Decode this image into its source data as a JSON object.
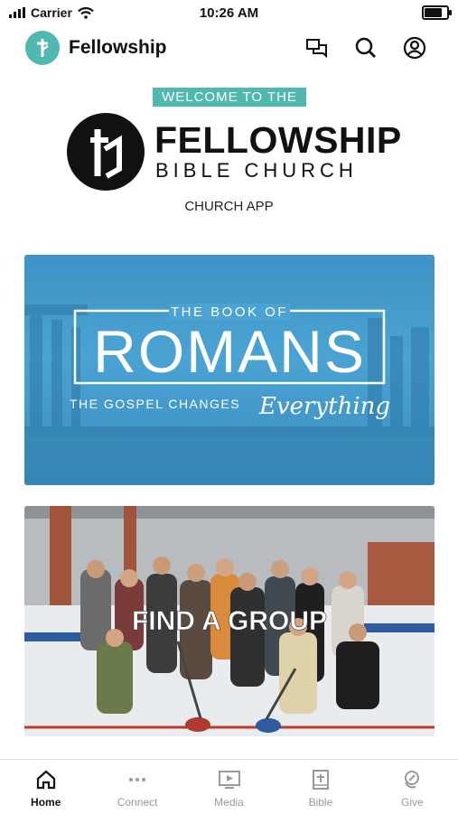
{
  "status": {
    "carrier": "Carrier",
    "time": "10:26 AM",
    "battery_level": 0.85
  },
  "header": {
    "title": "Fellowship",
    "icons": [
      "chat-icon",
      "search-icon",
      "account-icon"
    ]
  },
  "welcome": {
    "banner": "WELCOME TO THE",
    "logo_line1": "FELLOWSHIP",
    "logo_line2": "BIBLE CHURCH",
    "subtitle": "CHURCH APP"
  },
  "cards": [
    {
      "kicker": "THE BOOK OF",
      "title": "ROMANS",
      "tagline": "THE GOSPEL CHANGES",
      "script": "Everything"
    },
    {
      "title": "FIND A GROUP"
    }
  ],
  "nav": [
    {
      "label": "Home",
      "icon": "home-icon",
      "active": true
    },
    {
      "label": "Connect",
      "icon": "more-dots-icon",
      "active": false
    },
    {
      "label": "Media",
      "icon": "media-play-icon",
      "active": false
    },
    {
      "label": "Bible",
      "icon": "bible-icon",
      "active": false
    },
    {
      "label": "Give",
      "icon": "give-icon",
      "active": false
    }
  ],
  "colors": {
    "accent": "#4fb8b0",
    "romans_blue": "#4aa3d2"
  }
}
